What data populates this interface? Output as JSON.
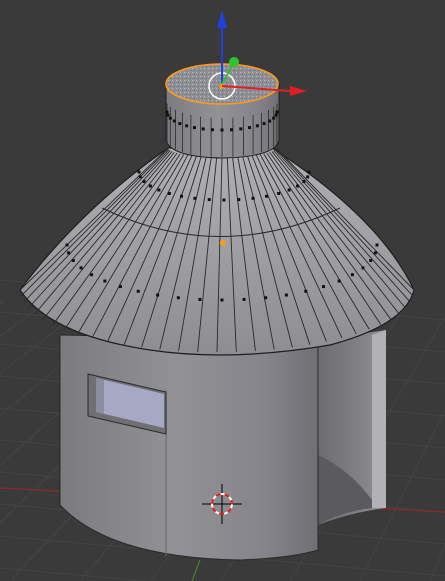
{
  "viewport": {
    "background": "#3a3a3a",
    "grid_color": "#444444",
    "x_axis_color": "#8e2a2a",
    "y_axis_color": "#4f7f1f"
  },
  "model": {
    "body_color": "#8f8f92",
    "roof_color": "#9a9a9e",
    "top_color": "#8a8a8e",
    "window_color": "#a7a9c4",
    "selection_color": "#ff9a1a"
  },
  "gizmo": {
    "x_color": "#e02020",
    "y_color": "#2ec42e",
    "z_color": "#1f3fe0"
  }
}
